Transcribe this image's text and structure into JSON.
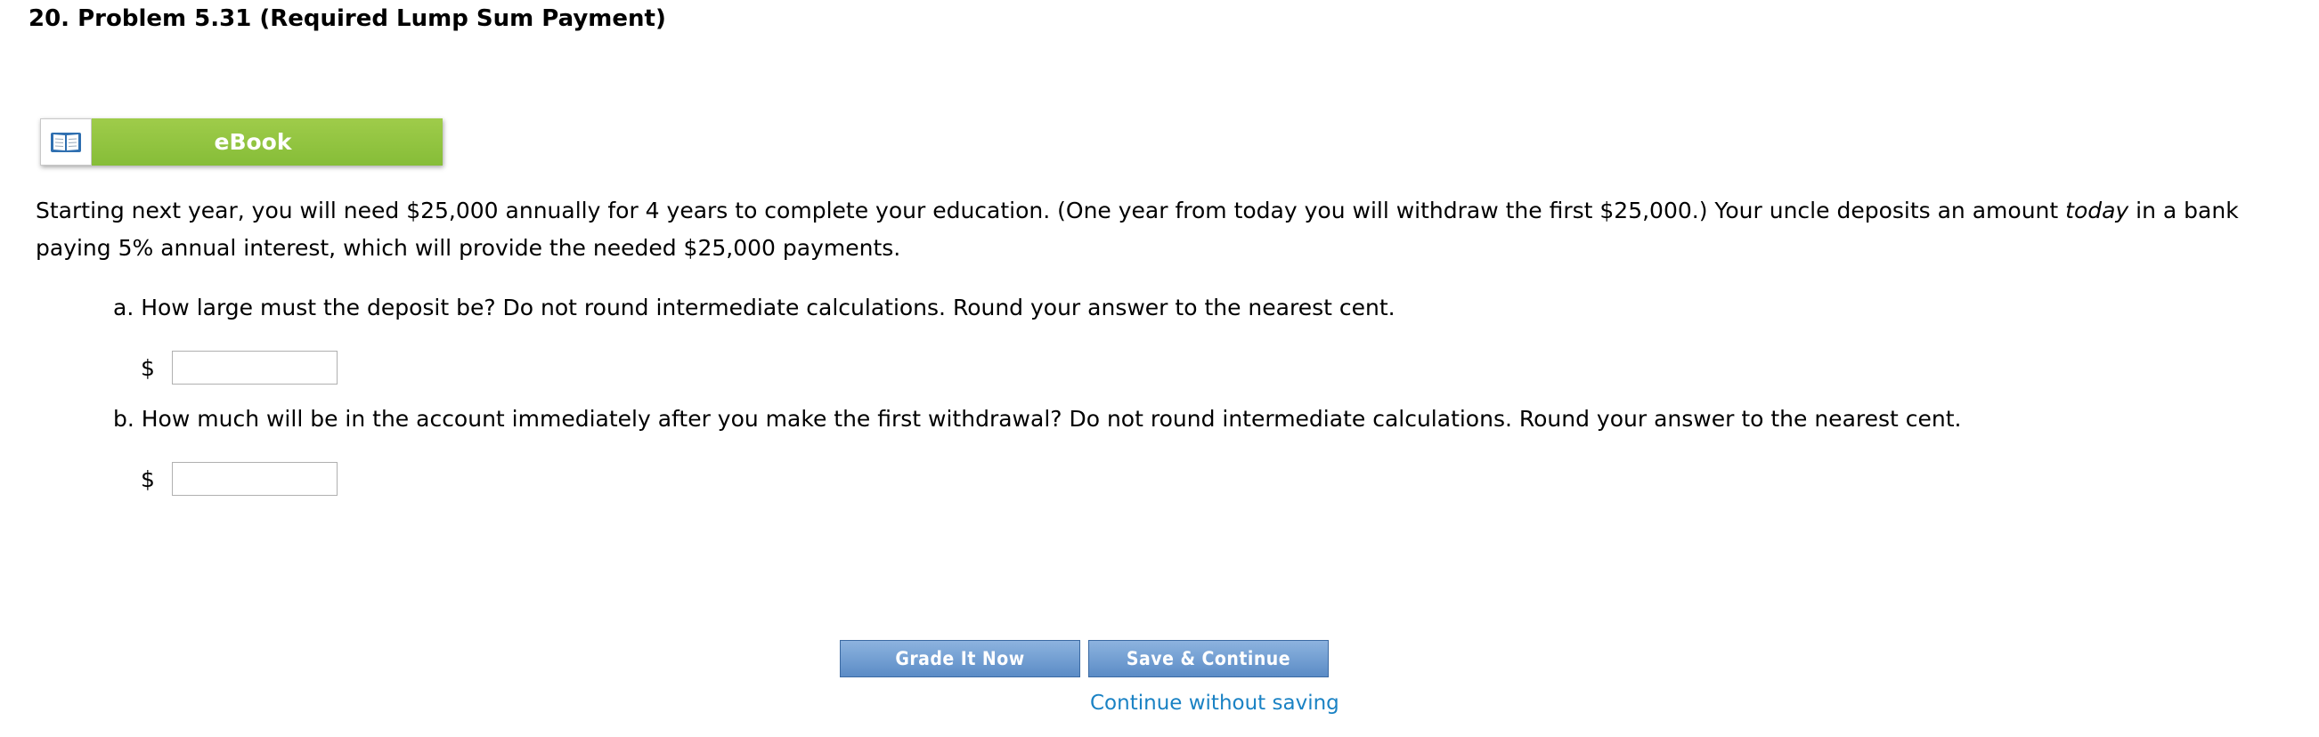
{
  "problem": {
    "title": "20.  Problem 5.31 (Required Lump Sum Payment)"
  },
  "ebook": {
    "icon": "open-book-icon",
    "label": "eBook",
    "color": "#8dc63f"
  },
  "body": {
    "text_before": "Starting next year, you will need $25,000 annually for 4 years to complete your education. (One year from today you will withdraw the first $25,000.) Your uncle deposits an amount ",
    "text_emphasis": "today",
    "text_after": " in a bank paying 5% annual interest, which will provide the needed $25,000 payments."
  },
  "questions": [
    {
      "text": "a. How large must the deposit be? Do not round intermediate calculations. Round your answer to the nearest cent.",
      "currency": "$",
      "value": ""
    },
    {
      "text": "b. How much will be in the account immediately after you make the first withdrawal? Do not round intermediate calculations. Round your answer to the nearest cent.",
      "currency": "$",
      "value": ""
    }
  ],
  "actions": {
    "grade_label": "Grade It Now",
    "save_label": "Save & Continue",
    "continue_link": "Continue without saving",
    "button_color": "#6f9bd2",
    "link_color": "#1a82c4"
  }
}
